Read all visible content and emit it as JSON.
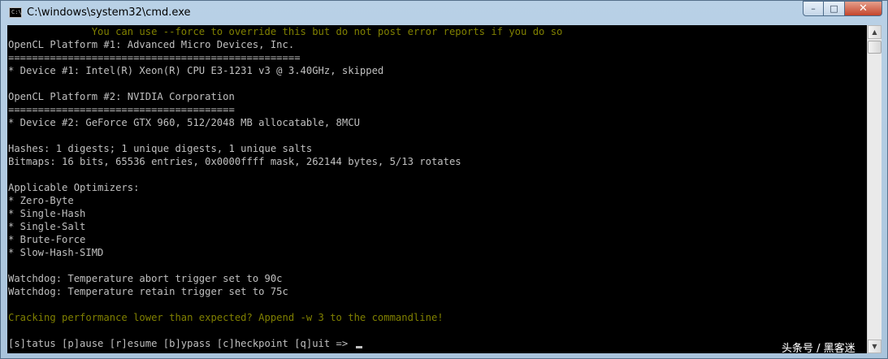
{
  "window": {
    "title": "C:\\windows\\system32\\cmd.exe",
    "icon_name": "cmd-icon",
    "controls": {
      "minimize": "–",
      "maximize": "□",
      "close": "✕"
    }
  },
  "console": {
    "lines": [
      {
        "text": "              You can use --force to override this but do not post error reports if you do so",
        "color": "#808000"
      },
      {
        "text": "OpenCL Platform #1: Advanced Micro Devices, Inc."
      },
      {
        "text": "================================================="
      },
      {
        "text": "* Device #1: Intel(R) Xeon(R) CPU E3-1231 v3 @ 3.40GHz, skipped"
      },
      {
        "text": ""
      },
      {
        "text": "OpenCL Platform #2: NVIDIA Corporation"
      },
      {
        "text": "======================================"
      },
      {
        "text": "* Device #2: GeForce GTX 960, 512/2048 MB allocatable, 8MCU"
      },
      {
        "text": ""
      },
      {
        "text": "Hashes: 1 digests; 1 unique digests, 1 unique salts"
      },
      {
        "text": "Bitmaps: 16 bits, 65536 entries, 0x0000ffff mask, 262144 bytes, 5/13 rotates"
      },
      {
        "text": ""
      },
      {
        "text": "Applicable Optimizers:"
      },
      {
        "text": "* Zero-Byte"
      },
      {
        "text": "* Single-Hash"
      },
      {
        "text": "* Single-Salt"
      },
      {
        "text": "* Brute-Force"
      },
      {
        "text": "* Slow-Hash-SIMD"
      },
      {
        "text": ""
      },
      {
        "text": "Watchdog: Temperature abort trigger set to 90c"
      },
      {
        "text": "Watchdog: Temperature retain trigger set to 75c"
      },
      {
        "text": ""
      },
      {
        "text": "Cracking performance lower than expected? Append -w 3 to the commandline!",
        "color": "#808000"
      },
      {
        "text": ""
      },
      {
        "text": "[s]tatus [p]ause [r]esume [b]ypass [c]heckpoint [q]uit => ",
        "cursor": true
      }
    ]
  },
  "scrollbar": {
    "up_arrow": "▲",
    "down_arrow": "▼"
  },
  "watermark": "头条号 / 黑客迷"
}
